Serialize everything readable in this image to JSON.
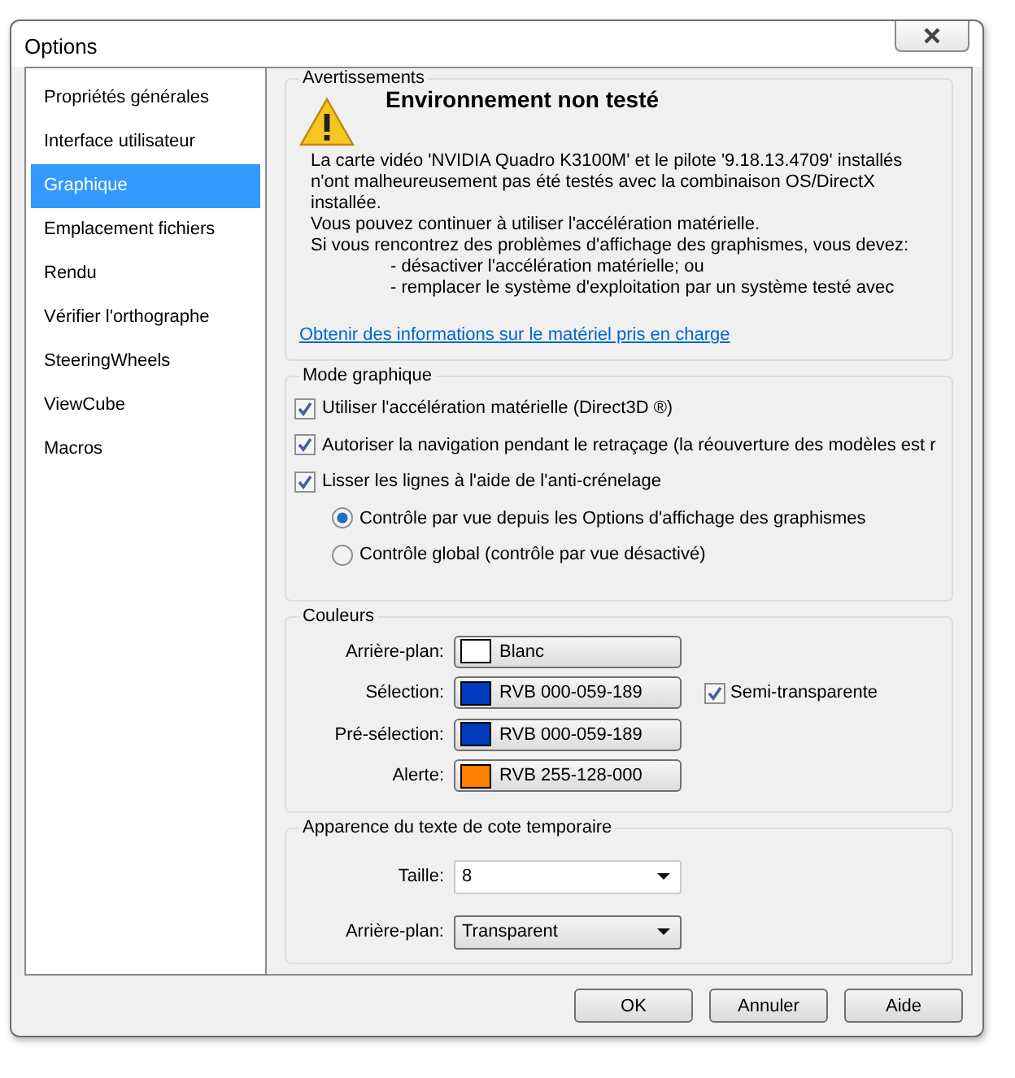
{
  "window": {
    "title": "Options"
  },
  "sidebar": {
    "items": [
      {
        "label": "Propriétés générales",
        "selected": false
      },
      {
        "label": "Interface utilisateur",
        "selected": false
      },
      {
        "label": "Graphique",
        "selected": true
      },
      {
        "label": "Emplacement fichiers",
        "selected": false
      },
      {
        "label": "Rendu",
        "selected": false
      },
      {
        "label": "Vérifier l'orthographe",
        "selected": false
      },
      {
        "label": "SteeringWheels",
        "selected": false
      },
      {
        "label": "ViewCube",
        "selected": false
      },
      {
        "label": "Macros",
        "selected": false
      }
    ]
  },
  "warnings": {
    "legend": "Avertissements",
    "heading": "Environnement non testé",
    "paragraphs": [
      {
        "kind": "text",
        "text": "La carte vidéo 'NVIDIA Quadro K3100M' et le pilote '9.18.13.4709' installés\nn'ont malheureusement pas été testés avec la combinaison OS/DirectX\ninstallée."
      },
      {
        "kind": "text",
        "text": "Vous pouvez continuer à utiliser l'accélération matérielle."
      },
      {
        "kind": "text",
        "text": "Si vous rencontrez des problèmes d'affichage des graphismes, vous devez:"
      },
      {
        "kind": "bullet",
        "text": "- désactiver l'accélération matérielle; ou"
      },
      {
        "kind": "bullet",
        "text": "- remplacer le système d'exploitation par un système testé avec"
      }
    ],
    "link": "Obtenir des informations sur le matériel pris en charge"
  },
  "graphics_mode": {
    "legend": "Mode graphique",
    "options": [
      {
        "kind": "checkbox",
        "label": "Utiliser l'accélération matérielle (Direct3D ®)",
        "checked": true
      },
      {
        "kind": "checkbox",
        "label": "Autoriser la navigation pendant le retraçage (la réouverture des modèles est r",
        "checked": true
      },
      {
        "kind": "checkbox",
        "label": "Lisser les lignes à l'aide de l'anti-crénelage",
        "checked": true
      },
      {
        "kind": "radio",
        "label": "Contrôle par vue depuis les Options d'affichage des graphismes",
        "selected": true
      },
      {
        "kind": "radio",
        "label": "Contrôle global (contrôle par vue désactivé)",
        "selected": false
      }
    ]
  },
  "colors": {
    "legend": "Couleurs",
    "rows": [
      {
        "label": "Arrière-plan:",
        "value": "Blanc",
        "color": "#ffffff"
      },
      {
        "label": "Sélection:",
        "value": "RVB 000-059-189",
        "color": "#003bbd",
        "option": {
          "label": "Semi-transparente",
          "checked": true
        }
      },
      {
        "label": "Pré-sélection:",
        "value": "RVB 000-059-189",
        "color": "#003bbd"
      },
      {
        "label": "Alerte:",
        "value": "RVB 255-128-000",
        "color": "#ff8000"
      }
    ]
  },
  "dimension_text": {
    "legend": "Apparence du texte de cote temporaire",
    "fields": [
      {
        "kind": "combo",
        "label": "Taille:",
        "value": "8"
      },
      {
        "kind": "dropdown",
        "label": "Arrière-plan:",
        "value": "Transparent"
      }
    ]
  },
  "buttons": [
    "OK",
    "Annuler",
    "Aide"
  ]
}
